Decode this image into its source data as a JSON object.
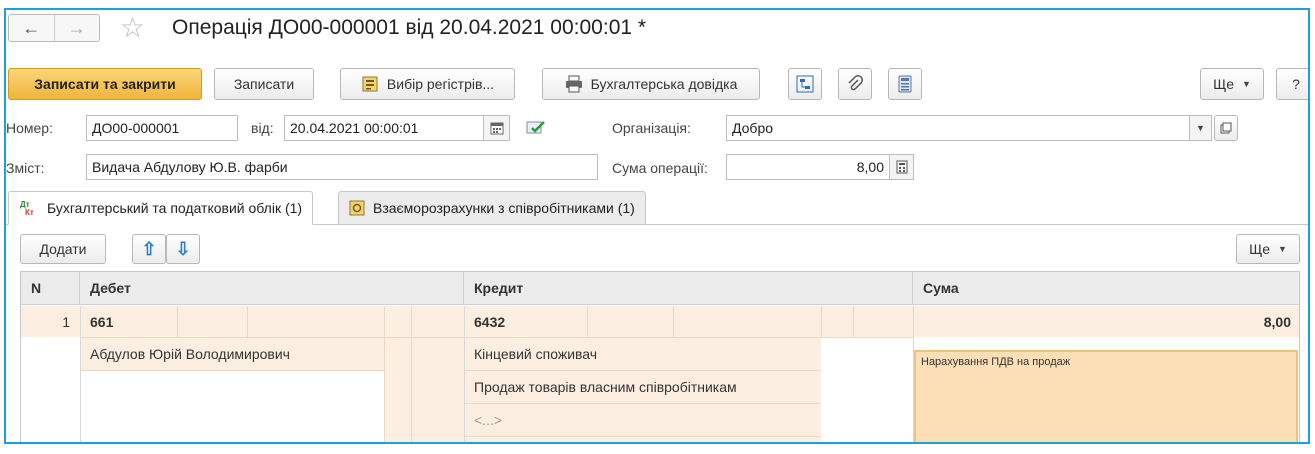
{
  "window": {
    "title": "Операція ДО00-000001 від 20.04.2021 00:00:01 *",
    "nav_back": "←",
    "nav_forward": "→",
    "favorite_glyph": "☆"
  },
  "toolbar": {
    "save_close": "Записати та закрити",
    "save": "Записати",
    "choose_registers": "Вибір регістрів...",
    "accounting_statement": "Бухгалтерська довідка",
    "more": "Ще",
    "help": "?"
  },
  "form": {
    "number_label": "Номер:",
    "number_value": "ДО00-000001",
    "date_label": "від:",
    "date_value": "20.04.2021 00:00:01",
    "org_label": "Організація:",
    "org_value": "Добро",
    "content_label": "Зміст:",
    "content_value": "Видача Абдулову Ю.В. фарби",
    "amount_label": "Сума операції:",
    "amount_value": "8,00"
  },
  "tabs": [
    {
      "label": "Бухгалтерський та податковий облік (1)",
      "icon": "dt-kt-icon",
      "active": true
    },
    {
      "label": "Взаєморозрахунки з співробітниками (1)",
      "icon": "settlements-icon",
      "active": false
    }
  ],
  "table_toolbar": {
    "add": "Додати",
    "up_glyph": "⇧",
    "down_glyph": "⇩",
    "more": "Ще"
  },
  "table": {
    "columns": [
      "N",
      "Дебет",
      "Кредит",
      "Сума"
    ],
    "rows": [
      {
        "n": "1",
        "debit_account": "661",
        "debit_subconto": [
          "Абдулов Юрій Володимирович"
        ],
        "credit_account": "6432",
        "credit_subconto": [
          "Кінцевий споживач",
          "Продаж товарів власним співробітникам",
          "<...>"
        ],
        "amount": "8,00",
        "comment": "Нарахування ПДВ на продаж"
      }
    ]
  },
  "colors": {
    "accent_frame": "#1aa3d9",
    "primary_button": "#f0b53b",
    "row_background": "#fdeee2",
    "comment_background": "#fcdfb6",
    "arrow_blue": "#2a7fd4"
  }
}
